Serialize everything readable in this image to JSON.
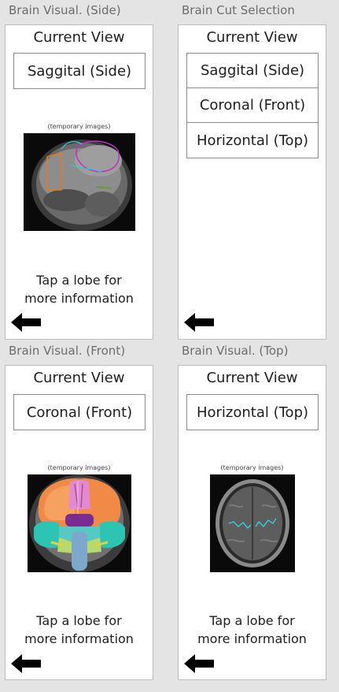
{
  "screens": {
    "side": {
      "caption": "Brain Visual. (Side)",
      "title": "Current View",
      "view_button": "Saggital (Side)",
      "image_note": "(temporary images)",
      "hint_line1": "Tap a lobe for",
      "hint_line2": "more information"
    },
    "selection": {
      "caption": "Brain Cut Selection",
      "title": "Current View",
      "options": [
        "Saggital (Side)",
        "Coronal (Front)",
        "Horizontal (Top)"
      ]
    },
    "front": {
      "caption": "Brain Visual. (Front)",
      "title": "Current View",
      "view_button": "Coronal (Front)",
      "image_note": "(temporary images)",
      "hint_line1": "Tap a lobe for",
      "hint_line2": "more information"
    },
    "top": {
      "caption": "Brain Visual. (Top)",
      "title": "Current View",
      "view_button": "Horizontal (Top)",
      "image_note": "(temporary images)",
      "hint_line1": "Tap a lobe for",
      "hint_line2": "more information"
    }
  },
  "icons": {
    "back": "back-arrow-icon"
  },
  "colors": {
    "background": "#e4e4e4",
    "card": "#ffffff",
    "caption_text": "#6c6c6c",
    "arrow": "#000000"
  }
}
